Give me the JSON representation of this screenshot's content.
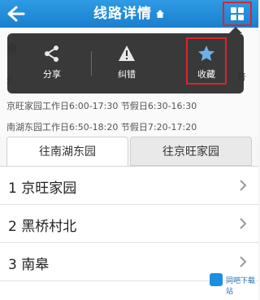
{
  "header": {
    "title": "线路详情"
  },
  "line_info": {
    "name_partial": "京",
    "left_char": "无",
    "right_char": "普",
    "schedules": [
      "京旺家园工作日6:00-17:30 节假日6:30-16:30",
      "南湖东园工作日6:50-18:20 节假日7:20-17:20"
    ]
  },
  "tabs": [
    {
      "label": "往南湖东园",
      "active": true
    },
    {
      "label": "往京旺家园",
      "active": false
    }
  ],
  "stops": [
    {
      "label": "1 京旺家园"
    },
    {
      "label": "2 黑桥村北"
    },
    {
      "label": "3 南皋"
    }
  ],
  "popup_menu": {
    "items": [
      {
        "label": "分享",
        "icon": "share-icon"
      },
      {
        "label": "纠错",
        "icon": "warning-icon"
      },
      {
        "label": "收藏",
        "icon": "star-icon"
      }
    ]
  },
  "watermark": {
    "text": "同吧下载站"
  },
  "colors": {
    "header": "#1e88d8",
    "highlight": "#d8262c",
    "popup": "#2d2d2d"
  }
}
